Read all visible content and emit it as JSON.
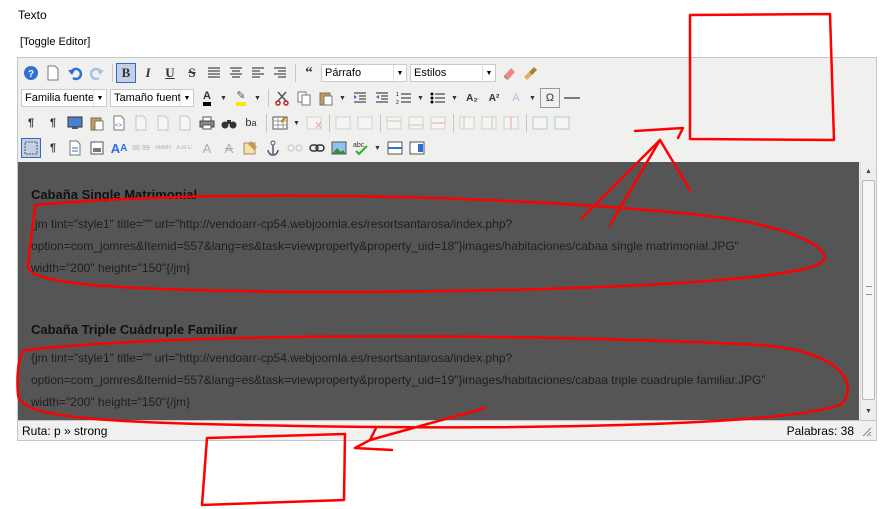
{
  "page": {
    "field_label": "Texto",
    "toggle_editor": "[Toggle Editor]"
  },
  "toolbar": {
    "format_select": "Párrafo",
    "styles_select": "Estilos",
    "font_family_select": "Familia fuente",
    "font_size_select": "Tamaño fuente",
    "bold": "B",
    "italic": "I",
    "underline": "U",
    "strike": "S",
    "quote": "“",
    "special_char": "Ω",
    "subscript": "A₂",
    "superscript": "A²",
    "font_color": "A",
    "backcolor": "✎",
    "cite": "66 99",
    "abbr": "ABBR",
    "acronym": "A.B.C.",
    "ins_text": "A",
    "del_text": "A",
    "spell": "abc",
    "ltr": "¶",
    "rtl": "¶",
    "pilcrow": "¶"
  },
  "content": {
    "heading1": "Cabaña Single Matrimonial",
    "para1_line1": "{jm tint=\"style1\" title=\"\" url=\"http://vendoarr-cp54.webjoomla.es/resortsantarosa/index.php?",
    "para1_line2": "option=com_jomres&Itemid=557&lang=es&task=viewproperty&property_uid=18\"}images/habitaciones/cabaa single matrimonial.JPG\"",
    "para1_line3": "width=\"200\" height=\"150\"{/jm}",
    "heading2": "Cabaña Triple Cuádruple Familiar",
    "para2_line1": "{jm tint=\"style1\" title=\"\" url=\"http://vendoarr-cp54.webjoomla.es/resortsantarosa/index.php?",
    "para2_line2": "option=com_jomres&Itemid=557&lang=es&task=viewproperty&property_uid=19\"}images/habitaciones/cabaa triple cuadruple familiar.JPG\"",
    "para2_line3": "width=\"200\" height=\"150\"{/jm}"
  },
  "status": {
    "path": "Ruta:  p » strong",
    "words": "Palabras: 38"
  },
  "colors": {
    "annotation": "#ff0000",
    "content_bg": "#555555",
    "toolbar_bg": "#f0f0ee",
    "active_border": "#316ac5"
  }
}
